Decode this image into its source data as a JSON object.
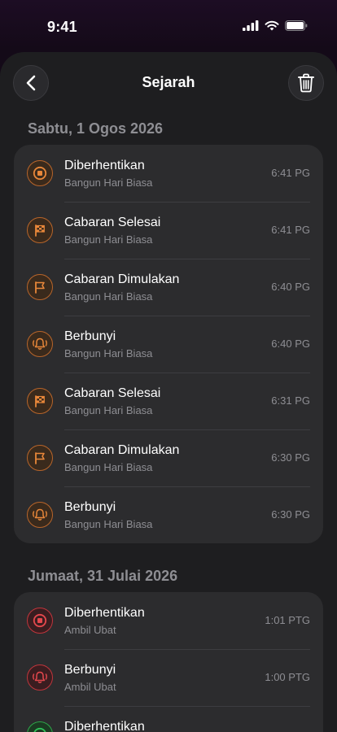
{
  "status": {
    "time": "9:41"
  },
  "nav": {
    "title": "Sejarah"
  },
  "colors": {
    "orange": "#e8873a",
    "red": "#e5484d",
    "green": "#30c058"
  },
  "sections": [
    {
      "date": "Sabtu, 1 Ogos 2026",
      "items": [
        {
          "title": "Diberhentikan",
          "subtitle": "Bangun Hari Biasa",
          "time": "6:41 PG",
          "icon": "stop-icon",
          "tone": "orange"
        },
        {
          "title": "Cabaran Selesai",
          "subtitle": "Bangun Hari Biasa",
          "time": "6:41 PG",
          "icon": "checkered-flag-icon",
          "tone": "orange"
        },
        {
          "title": "Cabaran Dimulakan",
          "subtitle": "Bangun Hari Biasa",
          "time": "6:40 PG",
          "icon": "flag-icon",
          "tone": "orange"
        },
        {
          "title": "Berbunyi",
          "subtitle": "Bangun Hari Biasa",
          "time": "6:40 PG",
          "icon": "ringing-bell-icon",
          "tone": "orange"
        },
        {
          "title": "Cabaran Selesai",
          "subtitle": "Bangun Hari Biasa",
          "time": "6:31 PG",
          "icon": "checkered-flag-icon",
          "tone": "orange"
        },
        {
          "title": "Cabaran Dimulakan",
          "subtitle": "Bangun Hari Biasa",
          "time": "6:30 PG",
          "icon": "flag-icon",
          "tone": "orange"
        },
        {
          "title": "Berbunyi",
          "subtitle": "Bangun Hari Biasa",
          "time": "6:30 PG",
          "icon": "ringing-bell-icon",
          "tone": "orange"
        }
      ]
    },
    {
      "date": "Jumaat, 31 Julai 2026",
      "items": [
        {
          "title": "Diberhentikan",
          "subtitle": "Ambil Ubat",
          "time": "1:01 PTG",
          "icon": "stop-icon",
          "tone": "red"
        },
        {
          "title": "Berbunyi",
          "subtitle": "Ambil Ubat",
          "time": "1:00 PTG",
          "icon": "ringing-bell-icon",
          "tone": "red"
        },
        {
          "title": "Diberhentikan",
          "subtitle": "",
          "time": "",
          "icon": "stop-icon",
          "tone": "green"
        }
      ]
    }
  ]
}
